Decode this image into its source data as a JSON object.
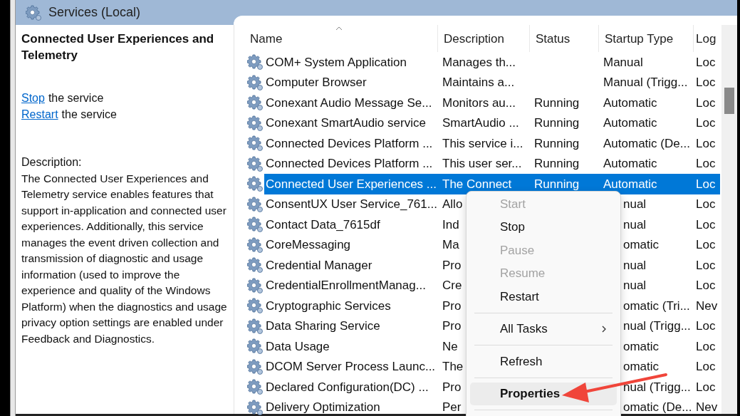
{
  "window": {
    "title": "Services (Local)"
  },
  "details": {
    "title": "Connected User Experiences and Telemetry",
    "actions": [
      {
        "link": "Stop",
        "text": "the service"
      },
      {
        "link": "Restart",
        "text": "the service"
      }
    ],
    "description_label": "Description:",
    "description": "The Connected User Experiences and Telemetry service enables features that support in-application and connected user experiences. Additionally, this service manages the event driven collection and transmission of diagnostic and usage information (used to improve the experience and quality of the Windows Platform) when the diagnostics and usage privacy option settings are enabled under Feedback and Diagnostics."
  },
  "table": {
    "columns": [
      "Name",
      "Description",
      "Status",
      "Startup Type",
      "Log"
    ],
    "rows": [
      {
        "name": "COM+ System Application",
        "description": "Manages th...",
        "startup_type": "Manual",
        "column_5": "Loc",
        "selected": false,
        "covered": false
      },
      {
        "name": "Computer Browser",
        "description": "Maintains a...",
        "startup_type": "Manual (Trigg...",
        "column_5": "Loc",
        "selected": false,
        "covered": false
      },
      {
        "name": "Conexant Audio Message Se...",
        "description": "Monitors au...",
        "status": "Running",
        "startup_type": "Automatic",
        "column_5": "Loc",
        "selected": false,
        "covered": false
      },
      {
        "name": "Conexant SmartAudio service",
        "description": "SmartAudio ...",
        "status": "Running",
        "startup_type": "Automatic",
        "column_5": "Loc",
        "selected": false,
        "covered": false
      },
      {
        "name": "Connected Devices Platform ...",
        "description": "This service i...",
        "status": "Running",
        "startup_type": "Automatic (De...",
        "column_5": "Loc",
        "selected": false,
        "covered": false
      },
      {
        "name": "Connected Devices Platform ...",
        "description": "This user ser...",
        "status": "Running",
        "startup_type": "Automatic",
        "column_5": "Loc",
        "selected": false,
        "covered": false
      },
      {
        "name": "Connected User Experiences ...",
        "description": "The Connect",
        "status": "Running",
        "startup_type": "Automatic",
        "column_5": "Loc",
        "selected": true,
        "covered": false
      },
      {
        "name": "ConsentUX User Service_761...",
        "description": "Allo",
        "startup_type": "nual",
        "column_5": "Loc",
        "selected": false,
        "covered": true
      },
      {
        "name": "Contact Data_7615df",
        "description": "Ind",
        "startup_type": "nual",
        "column_5": "Loc",
        "selected": false,
        "covered": true
      },
      {
        "name": "CoreMessaging",
        "description": "Ma",
        "startup_type": "omatic",
        "column_5": "Loc",
        "selected": false,
        "covered": true
      },
      {
        "name": "Credential Manager",
        "description": "Pro",
        "startup_type": "nual",
        "column_5": "Loc",
        "selected": false,
        "covered": true
      },
      {
        "name": "CredentialEnrollmentManag...",
        "description": "Cre",
        "startup_type": "nual",
        "column_5": "Loc",
        "selected": false,
        "covered": true
      },
      {
        "name": "Cryptographic Services",
        "description": "Pro",
        "startup_type": "omatic (Tri...",
        "column_5": "Nev",
        "selected": false,
        "covered": true
      },
      {
        "name": "Data Sharing Service",
        "description": "Pro",
        "startup_type": "nual (Trigg...",
        "column_5": "Loc",
        "selected": false,
        "covered": true
      },
      {
        "name": "Data Usage",
        "description": "Ne",
        "startup_type": "omatic",
        "column_5": "Loc",
        "selected": false,
        "covered": true
      },
      {
        "name": "DCOM Server Process Launc...",
        "description": "The",
        "startup_type": "omatic",
        "column_5": "Loc",
        "selected": false,
        "covered": true
      },
      {
        "name": "Declared Configuration(DC) ...",
        "description": "Pro",
        "startup_type": "nual (Trigg...",
        "column_5": "Loc",
        "selected": false,
        "covered": true
      },
      {
        "name": "Delivery Optimization",
        "description": "Per",
        "startup_type": "omatic (De...",
        "column_5": "Nev",
        "selected": false,
        "covered": true
      }
    ]
  },
  "context_menu": {
    "items": [
      {
        "kind": "item",
        "label": "Start",
        "disabled": true,
        "selected": false,
        "default": false,
        "submenu": false
      },
      {
        "kind": "item",
        "label": "Stop",
        "disabled": false,
        "selected": false,
        "default": false,
        "submenu": false
      },
      {
        "kind": "item",
        "label": "Pause",
        "disabled": true,
        "selected": false,
        "default": false,
        "submenu": false
      },
      {
        "kind": "item",
        "label": "Resume",
        "disabled": true,
        "selected": false,
        "default": false,
        "submenu": false
      },
      {
        "kind": "item",
        "label": "Restart",
        "disabled": false,
        "selected": false,
        "default": false,
        "submenu": false
      },
      {
        "kind": "separator"
      },
      {
        "kind": "item",
        "label": "All Tasks",
        "disabled": false,
        "selected": false,
        "default": false,
        "submenu": true
      },
      {
        "kind": "separator"
      },
      {
        "kind": "item",
        "label": "Refresh",
        "disabled": false,
        "selected": false,
        "default": false,
        "submenu": false
      },
      {
        "kind": "separator"
      },
      {
        "kind": "item",
        "label": "Properties",
        "disabled": false,
        "selected": true,
        "default": true,
        "submenu": false
      },
      {
        "kind": "separator"
      }
    ]
  }
}
